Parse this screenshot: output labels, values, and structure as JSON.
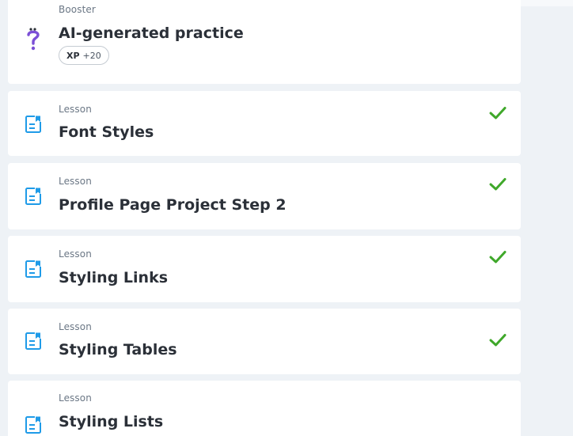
{
  "items": [
    {
      "type": "Booster",
      "title": "AI-generated practice",
      "icon": "question-mark-icon",
      "xp_label": "XP",
      "xp_value": "+20",
      "completed": false
    },
    {
      "type": "Lesson",
      "title": "Font Styles",
      "icon": "lesson-document-icon",
      "completed": true
    },
    {
      "type": "Lesson",
      "title": "Profile Page Project Step 2",
      "icon": "lesson-document-icon",
      "completed": true
    },
    {
      "type": "Lesson",
      "title": "Styling Links",
      "icon": "lesson-document-icon",
      "completed": true
    },
    {
      "type": "Lesson",
      "title": "Styling Tables",
      "icon": "lesson-document-icon",
      "completed": true
    },
    {
      "type": "Lesson",
      "title": "Styling Lists",
      "icon": "lesson-document-icon",
      "completed": false
    }
  ],
  "colors": {
    "background": "#eef2f6",
    "card": "#ffffff",
    "check": "#3fa82a",
    "lesson_icon": "#1f9be8",
    "booster_icon": "#7b4fd6",
    "title": "#2b3038",
    "subtitle": "#6b7785"
  }
}
